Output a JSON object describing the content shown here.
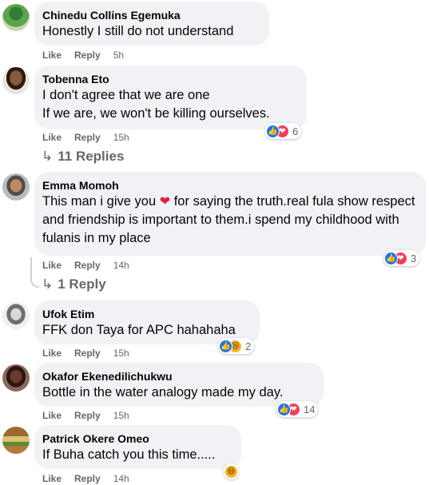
{
  "comments": [
    {
      "author": "Chinedu Collins Egemuka",
      "text": "Honestly I still do not understand",
      "like": "Like",
      "reply": "Reply",
      "time": "5h"
    },
    {
      "author": "Tobenna Eto",
      "text": "I don't agree that we are one\nIf we are, we won't be killing ourselves.",
      "like": "Like",
      "reply": "Reply",
      "time": "15h",
      "reaction_count": "6",
      "replies": "11 Replies"
    },
    {
      "author": "Emma Momoh",
      "text_before_heart": "This man i give you ",
      "text_after_heart": " for saying the truth.real fula show respect and friendship is important to them.i spend my childhood with fulanis in my place",
      "like": "Like",
      "reply": "Reply",
      "time": "14h",
      "reaction_count": "3",
      "replies": "1 Reply"
    },
    {
      "author": "Ufok Etim",
      "text": "FFK don Taya for APC hahahaha",
      "like": "Like",
      "reply": "Reply",
      "time": "15h",
      "reaction_count": "2"
    },
    {
      "author": "Okafor Ekenedilichukwu",
      "text": "Bottle in the water analogy made my day.",
      "like": "Like",
      "reply": "Reply",
      "time": "15h",
      "reaction_count": "14"
    },
    {
      "author": "Patrick Okere Omeo",
      "text": "If Buha catch you this time.....",
      "like": "Like",
      "reply": "Reply",
      "time": "14h"
    }
  ],
  "colors": {
    "bubble": "#f0f2f5",
    "like": "#1877f2",
    "love": "#f33e58",
    "haha": "#f7b125",
    "secondary_text": "#65676b"
  },
  "icons": [
    "like-reaction-icon",
    "love-reaction-icon",
    "haha-reaction-icon",
    "reply-arrow-icon",
    "heart-emoji-icon"
  ]
}
